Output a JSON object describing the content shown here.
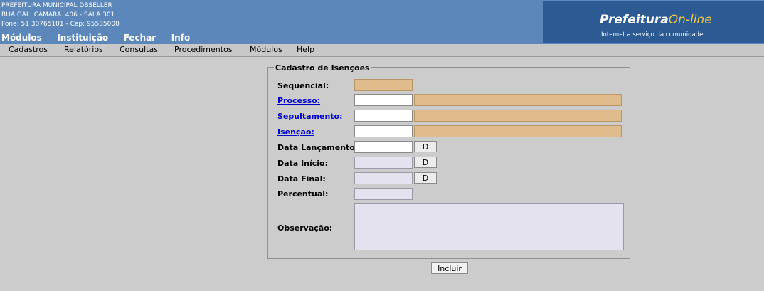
{
  "header": {
    "org_name": "PREFEITURA MUNICIPAL DBSELLER",
    "address": "RUA GAL. CAMARA. 406 - SALA 301",
    "contact": "Fone: 51 30765101  - Cep: 95585000",
    "top_menu": [
      "Módulos",
      "Instituição",
      "Fechar",
      "Info"
    ],
    "logo_brand": "Prefeitura",
    "logo_brand_suffix": "On-line",
    "logo_tagline": "Internet a serviço da comunidade"
  },
  "menubar": [
    "Cadastros",
    "Relatórios",
    "Consultas",
    "Procedimentos",
    "Módulos",
    "Help"
  ],
  "form": {
    "legend": "Cadastro de Isenções",
    "sequencial_label": "Sequencial:",
    "processo_label": "Processo:",
    "sepultamento_label": "Sepultamento:",
    "isencao_label": "Isenção:",
    "data_lancamento_label": "Data Lançamento:",
    "data_inicio_label": "Data Início:",
    "data_final_label": "Data Final:",
    "percentual_label": "Percentual:",
    "observacao_label": "Observação:",
    "date_button_label": "D",
    "submit_label": "Incluir"
  }
}
